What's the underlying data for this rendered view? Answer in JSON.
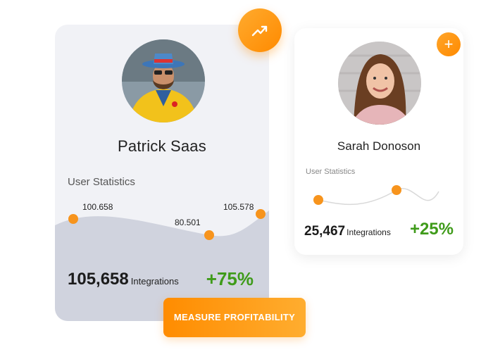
{
  "main_card": {
    "name": "Patrick Saas",
    "stats_title": "User Statistics",
    "points": [
      {
        "label": "100.658"
      },
      {
        "label": "80.501"
      },
      {
        "label": "105.578"
      }
    ],
    "total": "105,658",
    "total_unit": "Integrations",
    "change": "+75%"
  },
  "side_card": {
    "name": "Sarah Donoson",
    "stats_title": "User Statistics",
    "total": "25,467",
    "total_unit": "Integrations",
    "change": "+25%"
  },
  "badges": {
    "trend_icon": "trend-up-icon",
    "plus_icon": "plus-icon",
    "plus_symbol": "+"
  },
  "cta": {
    "label": "MEASURE PROFITABILITY"
  },
  "colors": {
    "accent_orange": "#ff8c00",
    "positive_green": "#3f9b1a",
    "card_bg": "#f1f2f6",
    "wave_fill": "#d0d3de"
  }
}
